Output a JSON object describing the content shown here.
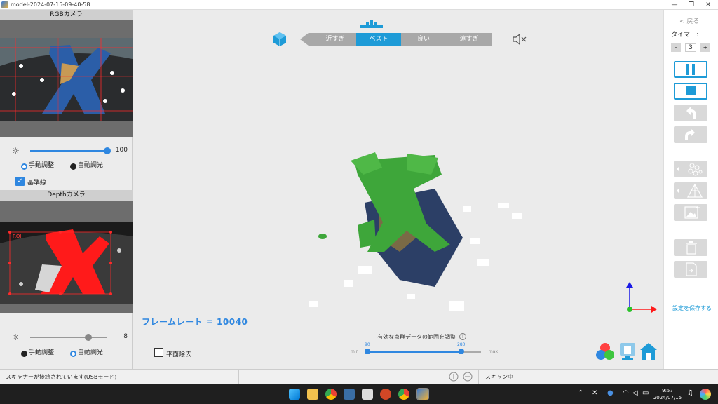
{
  "window": {
    "title": "model-2024-07-15-09-40-58",
    "minimize": "—",
    "restore": "❐",
    "close": "✕"
  },
  "left_panel": {
    "rgb_title": "RGBカメラ",
    "rgb_brightness_value": "100",
    "rgb_brightness_level": 1.0,
    "rgb_mode_manual": "手動調整",
    "rgb_mode_auto": "自動調光",
    "guide_lines": "基準線",
    "depth_title": "Depthカメラ",
    "roi_label": "ROI",
    "depth_exposure_value": "8",
    "depth_exposure_level": 0.75,
    "depth_mode_manual": "手動調整",
    "depth_mode_auto": "自動調光"
  },
  "viewport": {
    "distance_options": [
      "近すぎ",
      "ベスト",
      "良い",
      "遠すぎ"
    ],
    "distance_selected": "ベスト",
    "framerate_text": "フレームレート = 10040",
    "plane_removal": "平面除去",
    "range_title": "有効な点群データの範囲を調整",
    "range_min_label": "min",
    "range_max_label": "max",
    "range_low": "90",
    "range_high": "280"
  },
  "right_panel": {
    "back": "< 戻る",
    "timer_label": "タイマー:",
    "timer_minus": "-",
    "timer_value": "3",
    "timer_plus": "+",
    "save_settings": "設定を保存する"
  },
  "status": {
    "connection": "スキャナーが接続されています(USBモード)",
    "scan_state": "スキャン中"
  },
  "taskbar": {
    "time": "9:57",
    "date": "2024/07/15"
  },
  "colors": {
    "accent": "#1e9bd7",
    "active_blue": "#2f87e0",
    "point_green": "#3ea63a",
    "depth_red": "#ff0000"
  }
}
